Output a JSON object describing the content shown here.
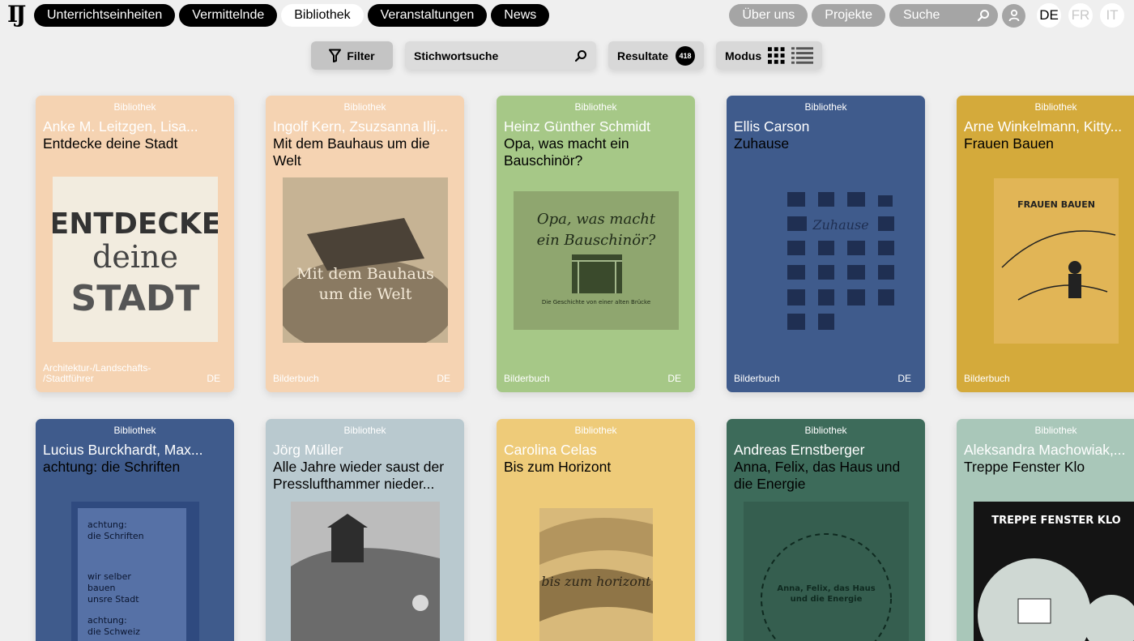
{
  "logo": "IJ",
  "nav_left": [
    "Unterrichtseinheiten",
    "Vermittelnde",
    "Bibliothek",
    "Veranstaltungen",
    "News"
  ],
  "nav_active": "Bibliothek",
  "nav_right": [
    "Über uns",
    "Projekte"
  ],
  "search": {
    "label": "Suche"
  },
  "languages": [
    "DE",
    "FR",
    "IT"
  ],
  "active_language": "DE",
  "toolbar": {
    "filter_label": "Filter",
    "keyword_placeholder": "Stichwortsuche",
    "results_label": "Resultate",
    "results_count": "418",
    "mode_label": "Modus"
  },
  "cards": [
    {
      "kind": "Bibliothek",
      "author": "Anke M. Leitzgen, Lisa...",
      "title": "Entdecke deine Stadt",
      "category": "Architektur-/Landschafts-\n/Stadtführer",
      "lang": "DE",
      "bg": "#f5d3b2",
      "cover_text": "ENTDECKE deine STADT"
    },
    {
      "kind": "Bibliothek",
      "author": "Ingolf Kern, Zsuzsanna Ilij...",
      "title": "Mit dem Bauhaus um die Welt",
      "category": "Bilderbuch",
      "lang": "DE",
      "bg": "#f5d3b2",
      "cover_text": "Mit dem Bauhaus um die Welt"
    },
    {
      "kind": "Bibliothek",
      "author": "Heinz Günther Schmidt",
      "title": "Opa, was macht ein Bauschinör?",
      "category": "Bilderbuch",
      "lang": "DE",
      "bg": "#a6c887",
      "cover_text": "Opa, was macht ein Bauschinör?",
      "cover_sub": "Die Geschichte von einer alten Brücke"
    },
    {
      "kind": "Bibliothek",
      "author": "Ellis Carson",
      "title": "Zuhause",
      "category": "Bilderbuch",
      "lang": "DE",
      "bg": "#3f5b8c",
      "cover_text": "Zuhause"
    },
    {
      "kind": "Bibliothek",
      "author": "Arne Winkelmann, Kitty...",
      "title": "Frauen Bauen",
      "category": "Bilderbuch",
      "lang": "",
      "bg": "#d4aa3b",
      "cover_text": "FRAUEN BAUEN"
    },
    {
      "kind": "Bibliothek",
      "author": "Lucius Burckhardt, Max...",
      "title": "achtung: die Schriften",
      "category": "",
      "lang": "",
      "bg": "#3f5b8c",
      "cover_text": "achtung: die Schriften"
    },
    {
      "kind": "Bibliothek",
      "author": "Jörg Müller",
      "title": "Alle Jahre wieder saust der Presslufthammer nieder...",
      "category": "",
      "lang": "",
      "bg": "#b9c9cf",
      "cover_text": ""
    },
    {
      "kind": "Bibliothek",
      "author": "Carolina Celas",
      "title": "Bis zum Horizont",
      "category": "",
      "lang": "",
      "bg": "#eecb79",
      "cover_text": "bis zum horizont"
    },
    {
      "kind": "Bibliothek",
      "author": "Andreas Ernstberger",
      "title": "Anna, Felix, das Haus und die Energie",
      "category": "",
      "lang": "",
      "bg": "#3d6b5a",
      "cover_text": "Anna, Felix, das Haus und die Energie"
    },
    {
      "kind": "Bibliothek",
      "author": "Aleksandra Machowiak,...",
      "title": "Treppe Fenster Klo",
      "category": "",
      "lang": "",
      "bg": "#a9c7b9",
      "cover_text": "TREPPE FENSTER KLO"
    }
  ]
}
